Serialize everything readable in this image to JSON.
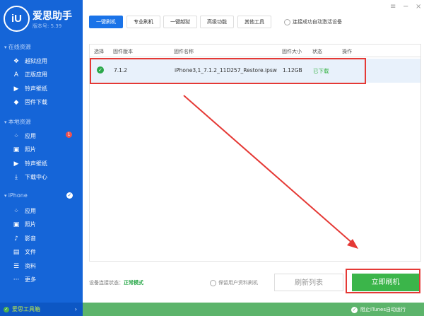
{
  "app": {
    "logo": "iU",
    "name": "爱思助手",
    "version": "版本号: 5.39"
  },
  "window": {
    "menu": "≡",
    "minimize": "−",
    "close": "×"
  },
  "sidebar": {
    "sections": [
      {
        "label": "在线资源",
        "items": [
          {
            "icon": "jailbreak-app-icon",
            "glyph": "❖",
            "label": "越狱应用"
          },
          {
            "icon": "app-store-icon",
            "glyph": "A",
            "label": "正版应用"
          },
          {
            "icon": "ringtone-icon",
            "glyph": "▶",
            "label": "铃声壁纸"
          },
          {
            "icon": "firmware-icon",
            "glyph": "◆",
            "label": "固件下载"
          }
        ]
      },
      {
        "label": "本地资源",
        "items": [
          {
            "icon": "apps-icon",
            "glyph": "⁘",
            "label": "应用",
            "badge": "1"
          },
          {
            "icon": "photo-icon",
            "glyph": "▣",
            "label": "照片"
          },
          {
            "icon": "ringtone-icon",
            "glyph": "▶",
            "label": "铃声壁纸"
          },
          {
            "icon": "download-icon",
            "glyph": "⤓",
            "label": "下载中心"
          }
        ]
      },
      {
        "label": "iPhone",
        "connected": true,
        "items": [
          {
            "icon": "apps-icon",
            "glyph": "⁘",
            "label": "应用"
          },
          {
            "icon": "photo-icon",
            "glyph": "▣",
            "label": "照片"
          },
          {
            "icon": "media-icon",
            "glyph": "♪",
            "label": "影音"
          },
          {
            "icon": "file-icon",
            "glyph": "▤",
            "label": "文件"
          },
          {
            "icon": "data-icon",
            "glyph": "☰",
            "label": "资料"
          },
          {
            "icon": "more-icon",
            "glyph": "···",
            "label": "更多"
          }
        ]
      }
    ],
    "toolbox": "爱思工具箱"
  },
  "tabs": [
    "一键刷机",
    "专业刷机",
    "一键越狱",
    "高级功能",
    "其他工具"
  ],
  "auto_activate": "连接成功自动激活设备",
  "table": {
    "headers": [
      "选择",
      "固件版本",
      "固件名称",
      "固件大小",
      "状态",
      "操作"
    ],
    "rows": [
      {
        "selected": true,
        "version": "7.1.2",
        "name": "iPhone3,1_7.1.2_11D257_Restore.ipsw",
        "size": "1.12GB",
        "status": "已下载",
        "action": ""
      }
    ]
  },
  "status": {
    "label": "设备连接状态：",
    "value": "正常模式"
  },
  "keep_data": "保留用户资料刷机",
  "refresh_label": "刷新列表",
  "flash_label": "立即刷机",
  "block_itunes": "阻止iTunes自动运行",
  "colors": {
    "sidebar": "#1565d8",
    "accent": "#1a73e8",
    "green": "#3bb54a",
    "highlight": "#e53935"
  }
}
